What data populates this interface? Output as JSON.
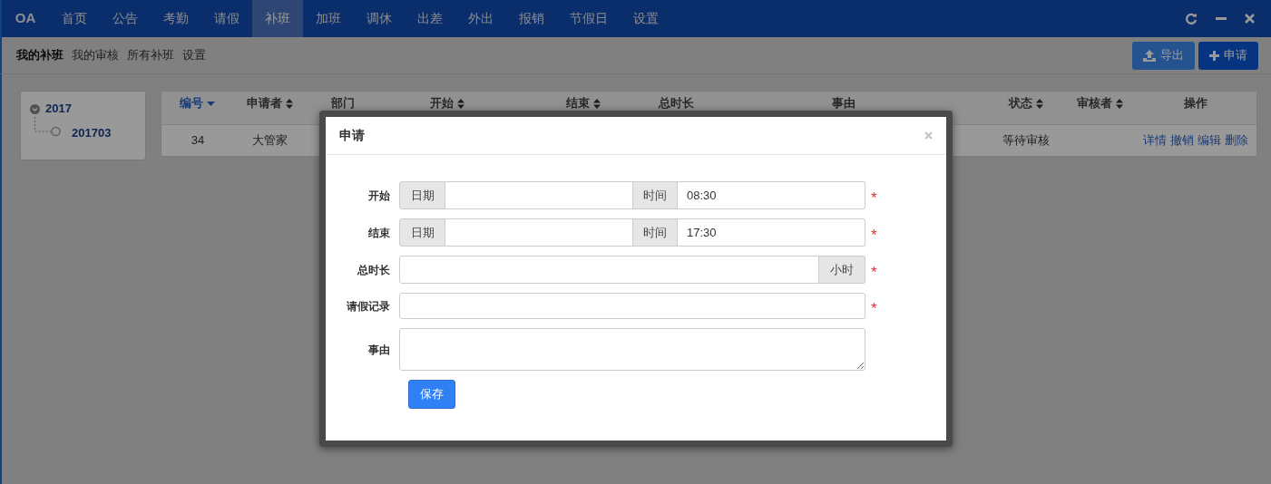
{
  "top_nav": {
    "logo": "OA",
    "items": [
      {
        "label": "首页",
        "selected": false
      },
      {
        "label": "公告",
        "selected": false
      },
      {
        "label": "考勤",
        "selected": false
      },
      {
        "label": "请假",
        "selected": false
      },
      {
        "label": "补班",
        "selected": true
      },
      {
        "label": "加班",
        "selected": false
      },
      {
        "label": "调休",
        "selected": false
      },
      {
        "label": "出差",
        "selected": false
      },
      {
        "label": "外出",
        "selected": false
      },
      {
        "label": "报销",
        "selected": false
      },
      {
        "label": "节假日",
        "selected": false
      },
      {
        "label": "设置",
        "selected": false
      }
    ]
  },
  "sub_nav": {
    "items": [
      {
        "label": "我的补班",
        "selected": true
      },
      {
        "label": "我的审核",
        "selected": false
      },
      {
        "label": "所有补班",
        "selected": false
      },
      {
        "label": "设置",
        "selected": false
      }
    ]
  },
  "toolbar": {
    "buttons": [
      {
        "label": "导出",
        "kind": "export"
      },
      {
        "label": "申请",
        "kind": "add"
      }
    ]
  },
  "tree": [
    {
      "label": "2017",
      "expanded": true,
      "children": [
        {
          "label": "201703"
        }
      ]
    }
  ],
  "table": {
    "columns": [
      {
        "label": "编号",
        "sortable": true,
        "sorted": true
      },
      {
        "label": "申请者",
        "sortable": true,
        "sorted": false
      },
      {
        "label": "部门",
        "sortable": false,
        "sorted": false
      },
      {
        "label": "开始",
        "sortable": true,
        "sorted": false
      },
      {
        "label": "结束",
        "sortable": true,
        "sorted": false
      },
      {
        "label": "总时长",
        "sortable": false,
        "sorted": false
      },
      {
        "label": "事由",
        "sortable": false,
        "sorted": false
      },
      {
        "label": "状态",
        "sortable": true,
        "sorted": false
      },
      {
        "label": "审核者",
        "sortable": true,
        "sorted": false
      },
      {
        "label": "操作",
        "sortable": false,
        "sorted": false
      }
    ],
    "rows": [
      {
        "id": "34",
        "applicant": "大管家",
        "status": "等待审核",
        "actions": [
          "详情",
          "撤销",
          "编辑",
          "删除"
        ]
      }
    ]
  },
  "dialog": {
    "title": "申请",
    "required_mark": "*",
    "fields": [
      {
        "kind": "datetime",
        "label": "开始",
        "date_addon": "日期",
        "time_addon": "时间",
        "time_value": "08:30",
        "required": true
      },
      {
        "kind": "datetime",
        "label": "结束",
        "date_addon": "日期",
        "time_addon": "时间",
        "time_value": "17:30",
        "required": true
      },
      {
        "kind": "unit",
        "label": "总时长",
        "unit": "小时",
        "required": true
      },
      {
        "kind": "text",
        "label": "请假记录",
        "required": true
      },
      {
        "kind": "textarea",
        "label": "事由",
        "required": false
      }
    ],
    "submit": "保存"
  }
}
